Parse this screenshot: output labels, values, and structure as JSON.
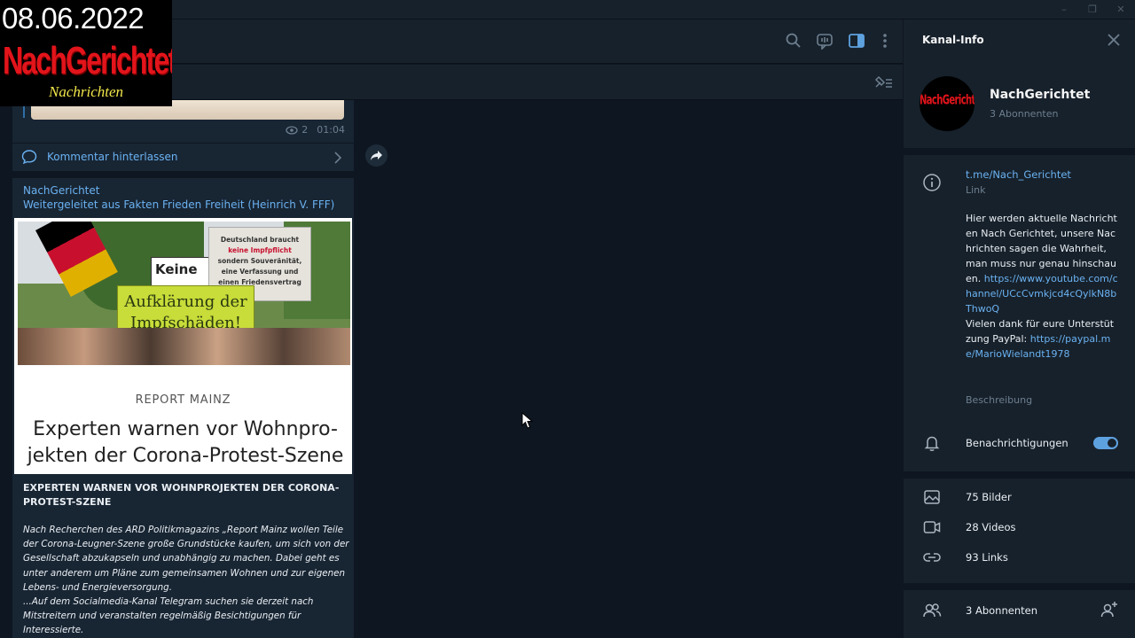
{
  "watermark": {
    "date": "08.06.2022",
    "brand": "NachGerichtet",
    "sub": "Nachrichten"
  },
  "window": {
    "min_icon": "minimize-icon",
    "max_icon": "maximize-icon",
    "close_icon": "close-icon"
  },
  "header": {
    "icons": [
      "search-icon",
      "voice-chat-icon",
      "sidebar-toggle-icon",
      "more-icon"
    ]
  },
  "pinned": {
    "icon": "pinned-list-icon"
  },
  "message1": {
    "views": "2",
    "time": "01:04",
    "comment_label": "Kommentar hinterlassen"
  },
  "message2": {
    "sender": "NachGerichtet",
    "forwarded_from": "Weitergeleitet aus Fakten Frieden Freiheit (Heinrich V. FFF)",
    "preview": {
      "photo_sign_green": "Aufklärung der Impfschäden!",
      "photo_sign_white_1": "Deutschland braucht",
      "photo_sign_white_2": "keine Impfpflicht",
      "photo_sign_white_3": "sondern Souveränität,",
      "photo_sign_white_4": "eine Verfassung und",
      "photo_sign_white_5": "einen Friedensvertrag",
      "photo_sign_keine": "Keine",
      "source": "REPORT MAINZ",
      "title": "Experten warnen vor Wohnpro-jekten der Corona-Protest-Szene"
    },
    "article_title": "EXPERTEN WARNEN VOR WOHNPROJEKTEN DER CORONA-PROTEST-SZENE",
    "article_body": "Nach Recherchen des ARD Politikmagazins „Report Mainz wollen Teile der Corona-Leugner-Szene große Grundstücke kaufen, um sich von der Gesellschaft abzukapseln und unabhängig zu machen. Dabei geht es unter anderem um Pläne zum gemeinsamen Wohnen und zur eigenen Lebens- und Energieversorgung.\n...Auf dem Socialmedia-Kanal Telegram suchen sie derzeit nach Mitstreitern und veranstalten regelmäßig Besichtigungen für Interessierte."
  },
  "panel": {
    "title": "Kanal-Info",
    "avatar_text": "NachGerichtet",
    "name": "NachGerichtet",
    "subscribers_sub": "3 Abonnenten",
    "link": "t.me/Nach_Gerichtet",
    "link_caption": "Link",
    "desc_text_1": "Hier werden aktuelle Nachrichten Nach Gerichtet, unsere Nachrichten sagen die Wahrheit, man muss nur genau hinschauen.",
    "desc_link_1": "https://www.youtube.com/channel/UCcCvmkjcd4cQylkN8bThwoQ",
    "desc_text_2": "Vielen dank für eure Unterstützung PayPal:",
    "desc_link_2": "https://paypal.me/MarioWielandt1978",
    "desc_caption": "Beschreibung",
    "notifications": "Benachrichtigungen",
    "notifications_on": true,
    "photos": "75 Bilder",
    "videos": "28 Videos",
    "links": "93 Links",
    "members": "3 Abonnenten"
  }
}
